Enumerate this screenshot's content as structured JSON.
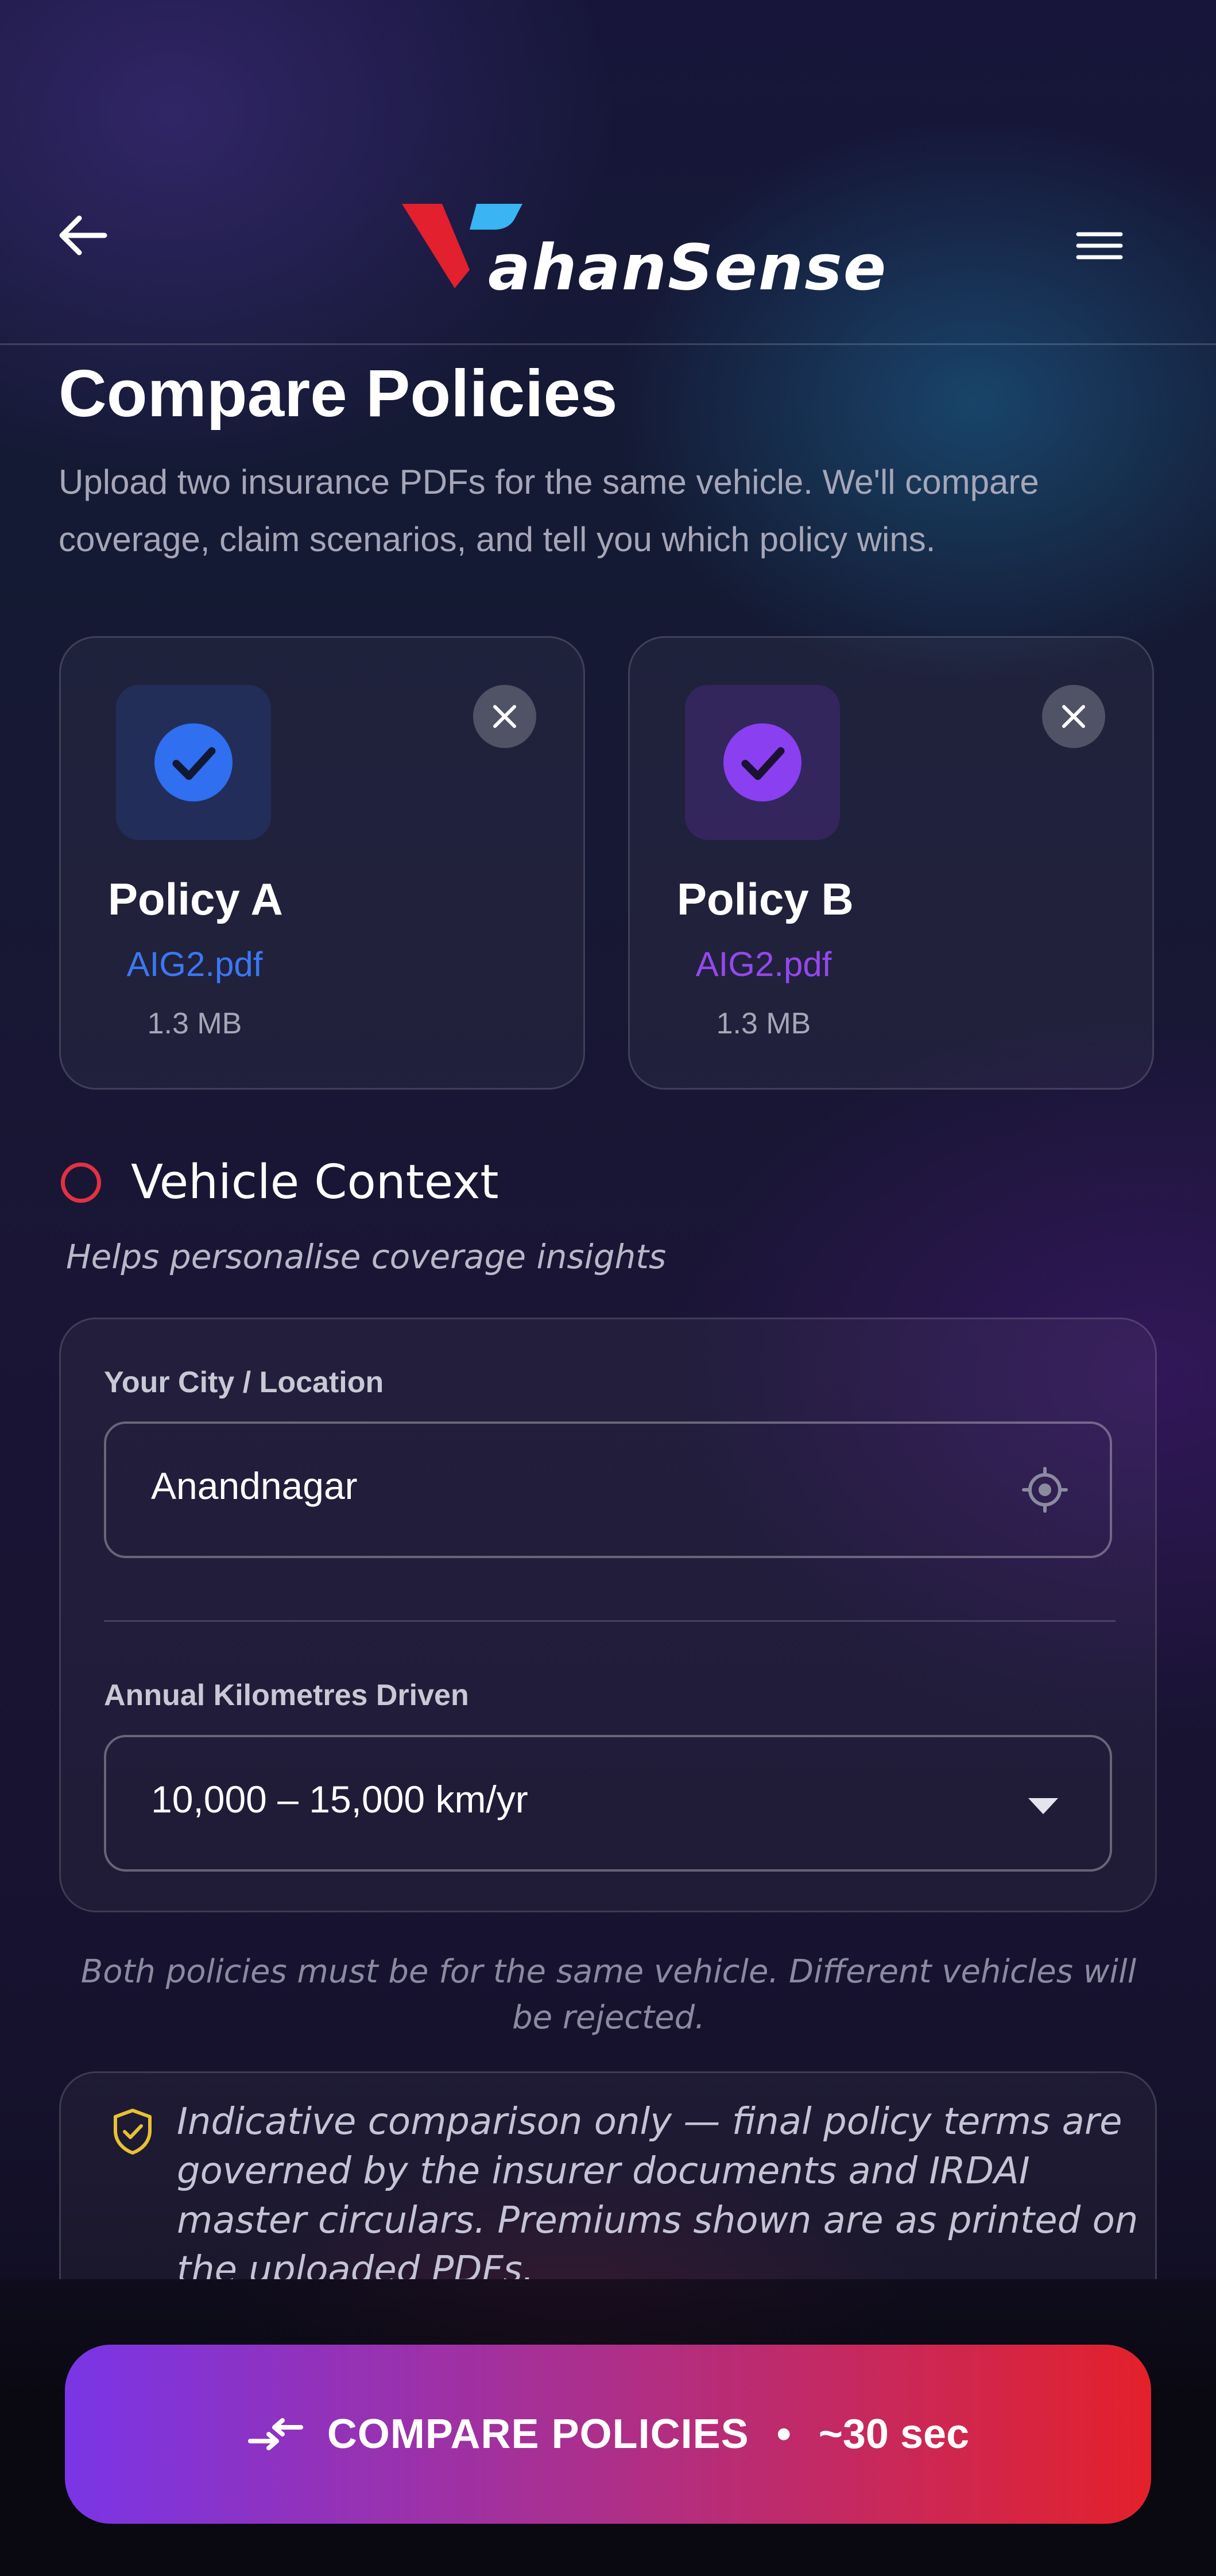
{
  "header": {
    "logo_text": "ahanSense",
    "back_icon": "arrow-left-icon",
    "menu_icon": "hamburger-menu-icon"
  },
  "page": {
    "title": "Compare Policies",
    "subtitle": "Upload two insurance PDFs for the same vehicle. We'll compare coverage, claim scenarios, and tell you which policy wins."
  },
  "policies": [
    {
      "title": "Policy A",
      "file_name": "AIG2.pdf",
      "file_size": "1.3 MB",
      "accent": "#2f6ff0",
      "icon": "check-circle-icon"
    },
    {
      "title": "Policy B",
      "file_name": "AIG2.pdf",
      "file_size": "1.3 MB",
      "accent": "#8a3ff0",
      "icon": "check-circle-icon"
    }
  ],
  "vehicle_context": {
    "title": "Vehicle Context",
    "subtitle": "Helps personalise coverage insights",
    "city_label": "Your City / Location",
    "city_value": "Anandnagar",
    "km_label": "Annual Kilometres Driven",
    "km_value": "10,000 – 15,000 km/yr"
  },
  "note": "Both policies must be for the same vehicle. Different vehicles will be rejected.",
  "disclaimer": "Indicative comparison only — final policy terms are governed by the insurer documents and IRDAI master circulars. Premiums shown are as printed on the uploaded PDFs.",
  "cta": {
    "label": "COMPARE POLICIES",
    "separator": "•",
    "time": "~30 sec"
  },
  "colors": {
    "brand_red": "#e2202e",
    "brand_blue": "#3ab4f2",
    "accent_a": "#2f6ff0",
    "accent_b": "#8a3ff0",
    "shield_yellow": "#e9c033"
  }
}
